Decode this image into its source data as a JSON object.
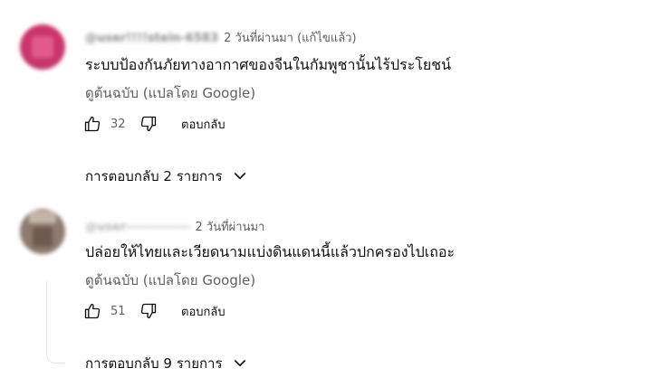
{
  "comments": [
    {
      "author": "@user!!!!stein-6583",
      "time": "2 วันที่ผ่านมา (แก้ไขแล้ว)",
      "text": "ระบบป้องกันภัยทางอากาศของจีนในกัมพูชานั้นไร้ประโยชน์",
      "translate_label": "ดูต้นฉบับ (แปลโดย Google)",
      "likes": "32",
      "reply_label": "ตอบกลับ",
      "replies_label": "การตอบกลับ 2 รายการ"
    },
    {
      "author": "@user-------------",
      "time": "2 วันที่ผ่านมา",
      "text": "ปล่อยให้ไทยและเวียดนามแบ่งดินแดนนี้แล้วปกครองไปเถอะ",
      "translate_label": "ดูต้นฉบับ (แปลโดย Google)",
      "likes": "51",
      "reply_label": "ตอบกลับ",
      "replies_label": "การตอบกลับ 9 รายการ"
    }
  ],
  "icons": {
    "like": "thumbs-up-icon",
    "dislike": "thumbs-down-icon",
    "expand": "chevron-down-icon"
  },
  "colors": {
    "text_primary": "#0f0f0f",
    "text_secondary": "#606060",
    "avatar_1": "#c8366b",
    "avatar_2": "#8d7a70"
  }
}
